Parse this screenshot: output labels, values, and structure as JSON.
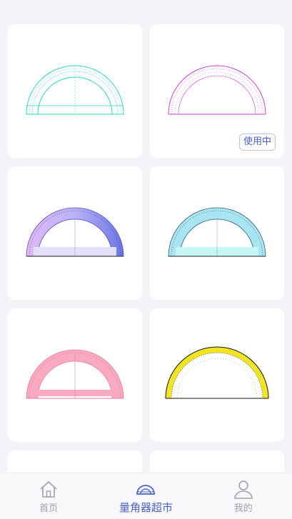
{
  "products": [
    {
      "style": "teal-outline"
    },
    {
      "style": "magenta-outline",
      "badge": "使用中"
    },
    {
      "style": "purple-gradient"
    },
    {
      "style": "cyan-fill"
    },
    {
      "style": "pink-fill"
    },
    {
      "style": "yellow-black"
    },
    {
      "style": "partial"
    },
    {
      "style": "partial"
    }
  ],
  "tabbar": {
    "home": {
      "label": "首页",
      "icon": "home-icon"
    },
    "market": {
      "label": "量角器超市",
      "icon": "protractor-icon"
    },
    "mine": {
      "label": "我的",
      "icon": "user-icon"
    }
  },
  "colors": {
    "accent": "#4a63c7",
    "teal": "#2ad6c6",
    "magenta": "#d63ad8",
    "purple": "#7d6ef0",
    "cyan": "#7fd7e8",
    "pink": "#f59ab4",
    "yellow": "#f2e423"
  }
}
